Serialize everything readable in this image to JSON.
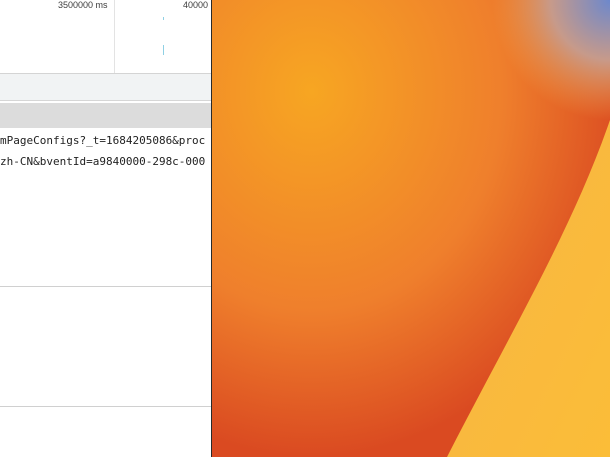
{
  "timeline": {
    "tick1_label": "3500000 ms",
    "tick2_label": "40000"
  },
  "requests": [
    {
      "url": "mPageConfigs?_t=1684205086&proc"
    },
    {
      "url": "zh-CN&bventId=a9840000-298c-000"
    }
  ],
  "colors": {
    "wallpaper_top": "#f6a21d",
    "wallpaper_bottom": "#d8431f",
    "wallpaper_highlight": "#fbb63a",
    "wallpaper_corner": "#7b8fc8"
  }
}
